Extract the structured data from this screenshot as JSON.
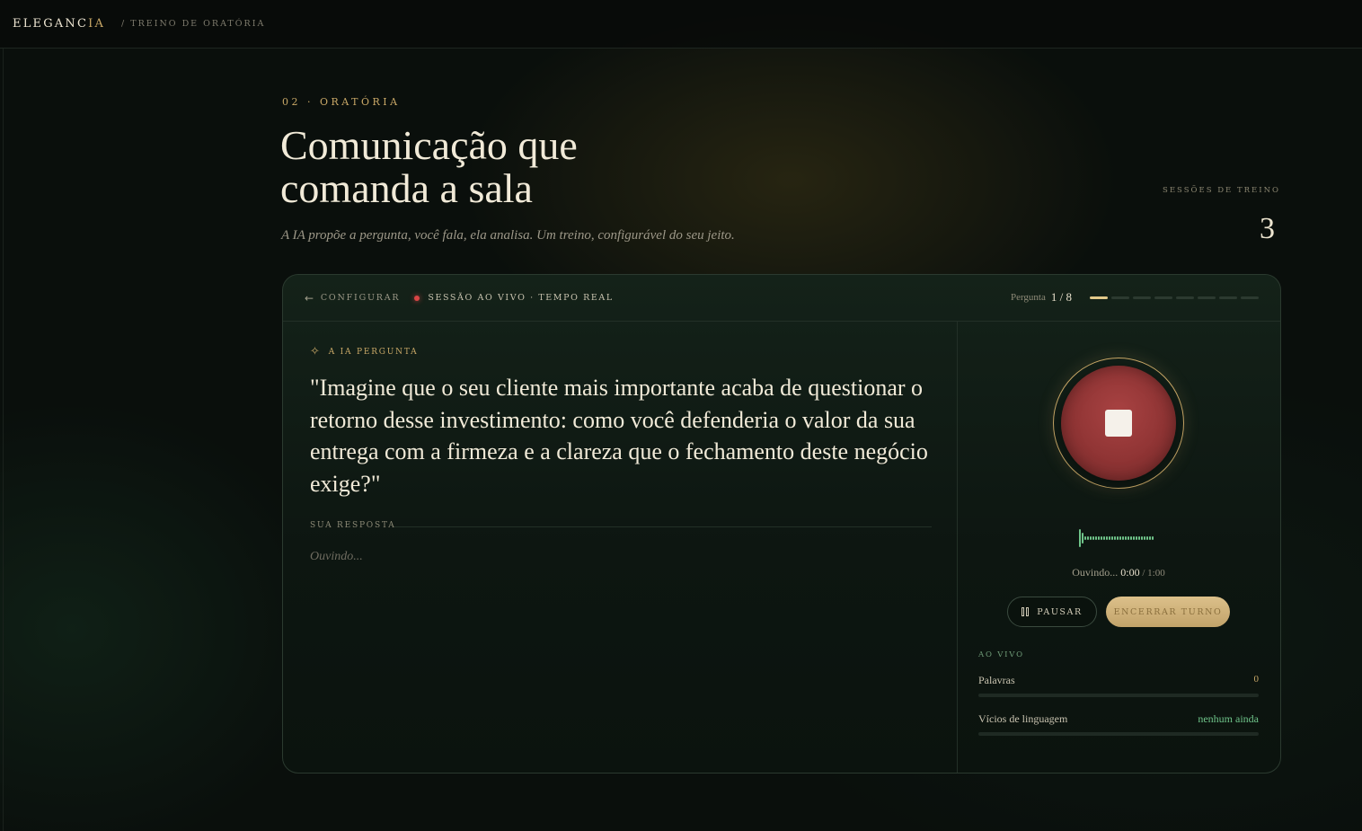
{
  "header": {
    "brand_main": "ELEGANC",
    "brand_accent": "IA",
    "breadcrumb": "/ TREINO DE ORATÓRIA"
  },
  "hero": {
    "eyebrow": "02 · ORATÓRIA",
    "title_line1": "Comunicação que",
    "title_line2": "comanda a sala",
    "subtitle": "A IA propõe a pergunta, você fala, ela analisa. Um treino, configurável do seu jeito.",
    "sessions_label": "SESSÕES DE TREINO",
    "sessions_value": "3"
  },
  "session": {
    "back_label": "CONFIGURAR",
    "live_label": "SESSÃO AO VIVO · TEMPO REAL",
    "question_label": "Pergunta",
    "question_progress": "1 / 8",
    "question_current": 1,
    "question_total": 8
  },
  "prompt": {
    "label": "A IA PERGUNTA",
    "text": "\"Imagine que o seu cliente mais importante acaba de questionar o retorno desse investimento: como você defenderia o valor da sua entrega com a firmeza e a clareza que o fechamento deste negócio exige?\"",
    "answer_label": "SUA RESPOSTA",
    "answer_placeholder": "Ouvindo..."
  },
  "recorder": {
    "status": "Ouvindo...",
    "elapsed": "0:00",
    "separator": " / ",
    "limit": "1:00",
    "pause_label": "PAUSAR",
    "end_label": "ENCERRAR TURNO"
  },
  "live_stats": {
    "title": "AO VIVO",
    "words_label": "Palavras",
    "words_value": "0",
    "words_fill": 0,
    "fillers_label": "Vícios de linguagem",
    "fillers_value": "nenhum ainda",
    "fillers_fill": 0
  },
  "icons": {
    "back": "arrow-left-icon",
    "live": "live-dot-icon",
    "ai": "sparkle-icon",
    "record": "stop-icon",
    "pause": "pause-icon"
  },
  "colors": {
    "accent_gold": "#c9a867",
    "live_red": "#d94545",
    "record_red": "#8f3434",
    "wave_green": "#6fc48a",
    "background": "#0a0f0c"
  }
}
